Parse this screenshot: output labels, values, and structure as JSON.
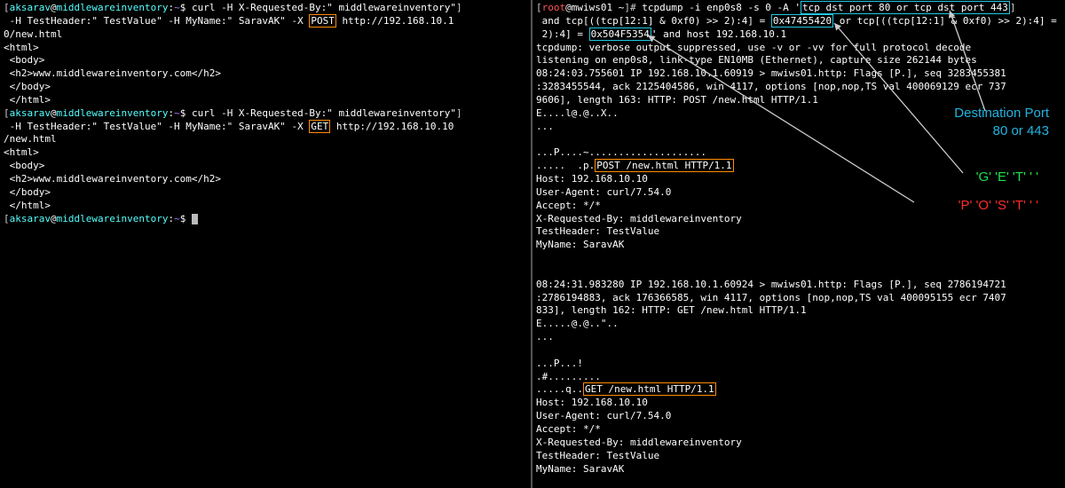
{
  "left": {
    "prompt_user": "aksarav",
    "prompt_host": "middlewareinventory",
    "prompt_path": "~",
    "cmd1_a": "curl -H X-Requested-By:\" middlewareinventory\"",
    "cmd1_b": " -H TestHeader:\" TestValue\" -H MyName:\" SaravAK\" -X ",
    "cmd1_method": "POST",
    "cmd1_c": " http://192.168.10.1",
    "cmd1_d": "0/new.html",
    "resp_l1": "<html>",
    "resp_l2": " <body>",
    "resp_l3": " <h2>www.middlewareinventory.com</h2>",
    "resp_l4": " </body>",
    "resp_l5": " </html>",
    "cmd2_a": "curl -H X-Requested-By:\" middlewareinventory\"",
    "cmd2_b": " -H TestHeader:\" TestValue\" -H MyName:\" SaravAK\" -X ",
    "cmd2_method": "GET",
    "cmd2_c": " http://192.168.10.10",
    "cmd2_d": "/new.html"
  },
  "right": {
    "prompt_root": "root",
    "prompt_host": "mwiws01",
    "prompt_path": "~",
    "cmd_a": "tcpdump -i enp0s8 -s 0 -A '",
    "cmd_filter1": "tcp dst port 80 or tcp dst port 443",
    "cmd_b": " and tcp[((tcp[12:1] & 0xf0) >> 2):4] = ",
    "cmd_hex1": "0x47455420",
    "cmd_c": " or tcp[((tcp[12:1] & 0xf0) >> 2):4] = ",
    "cmd_hex2": "0x504F5354",
    "cmd_d": "' and host 192.168.10.1",
    "out_l1": "tcpdump: verbose output suppressed, use -v or -vv for full protocol decode",
    "out_l2": "listening on enp0s8, link-type EN10MB (Ethernet), capture size 262144 bytes",
    "out_l3": "08:24:03.755601 IP 192.168.10.1.60919 > mwiws01.http: Flags [P.], seq 3283455381",
    "out_l4": ":3283455544, ack 2125404586, win 4117, options [nop,nop,TS val 400069129 ecr 737",
    "out_l5": "9606], length 163: HTTP: POST /new.html HTTP/1.1",
    "out_l6": "E....l@.@..X..",
    "out_l7": "...",
    "dots1a": "...P....~....................",
    "dots1b": ".....  .p.",
    "post_box": "POST /new.html HTTP/1.1",
    "hdr_host": "Host: 192.168.10.10",
    "hdr_ua": "User-Agent: curl/7.54.0",
    "hdr_accept": "Accept: */*",
    "hdr_xreq": "X-Requested-By: middlewareinventory",
    "hdr_th": "TestHeader: TestValue",
    "hdr_mn": "MyName: SaravAK",
    "blank": "",
    "out2_l1": "08:24:31.983280 IP 192.168.10.1.60924 > mwiws01.http: Flags [P.], seq 2786194721",
    "out2_l2": ":2786194883, ack 176366585, win 4117, options [nop,nop,TS val 400095155 ecr 7407",
    "out2_l3": "833], length 162: HTTP: GET /new.html HTTP/1.1",
    "out2_l4": "E.....@.@..\"..",
    "out2_l5": "...",
    "dots2a": "...P...!",
    "dots2b": ".#.........",
    "dots2c": ".....q..",
    "get_box": "GET /new.html HTTP/1.1"
  },
  "annotations": {
    "dest_port": "Destination Port\n80 or 443",
    "get_letters": "'G' 'E' 'T' ' '",
    "post_letters": "'P' 'O' 'S' 'T' ' '"
  }
}
